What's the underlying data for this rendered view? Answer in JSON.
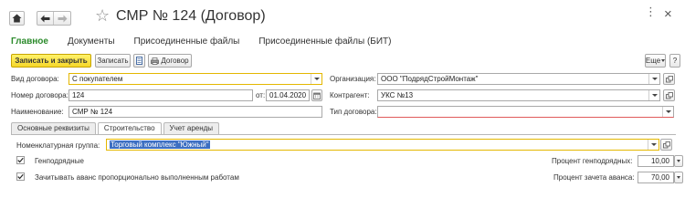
{
  "window": {
    "title": "СМР № 124 (Договор)",
    "more_label": "⋮",
    "close_label": "×"
  },
  "sections": [
    {
      "label": "Главное"
    },
    {
      "label": "Документы"
    },
    {
      "label": "Присоединенные файлы"
    },
    {
      "label": "Присоединенные файлы (БИТ)"
    }
  ],
  "toolbar": {
    "save_close_label": "Записать и закрыть",
    "save_label": "Записать",
    "print_label": "Договор",
    "more_label": "Еще",
    "help_label": "?"
  },
  "form": {
    "contract_kind": {
      "label": "Вид договора:",
      "value": "С покупателем"
    },
    "contract_number": {
      "label": "Номер договора:",
      "value": "124"
    },
    "date": {
      "label": "от:",
      "value": "01.04.2020"
    },
    "name": {
      "label": "Наименование:",
      "value": "СМР № 124"
    },
    "organization": {
      "label": "Организация:",
      "value": "ООО \"ПодрядСтройМонтаж\""
    },
    "counterparty": {
      "label": "Контрагент:",
      "value": "УКС №13"
    },
    "contract_type": {
      "label": "Тип договора:",
      "value": ""
    }
  },
  "tabs": [
    {
      "label": "Основные реквизиты",
      "active": false
    },
    {
      "label": "Строительство",
      "active": true
    },
    {
      "label": "Учет аренды",
      "active": false
    }
  ],
  "construction": {
    "nomenclature_group": {
      "label": "Номенклатурная группа:",
      "value": "Торговый комплекс \"Южный\""
    },
    "general_contract": {
      "label": "Генподрядные",
      "checked": true
    },
    "general_percent": {
      "label": "Процент генподрядных:",
      "value": "10,00"
    },
    "offset_advance": {
      "label": "Зачитывать аванс пропорционально выполненным работам",
      "checked": true
    },
    "advance_percent": {
      "label": "Процент зачета аванса:",
      "value": "70,00"
    }
  }
}
